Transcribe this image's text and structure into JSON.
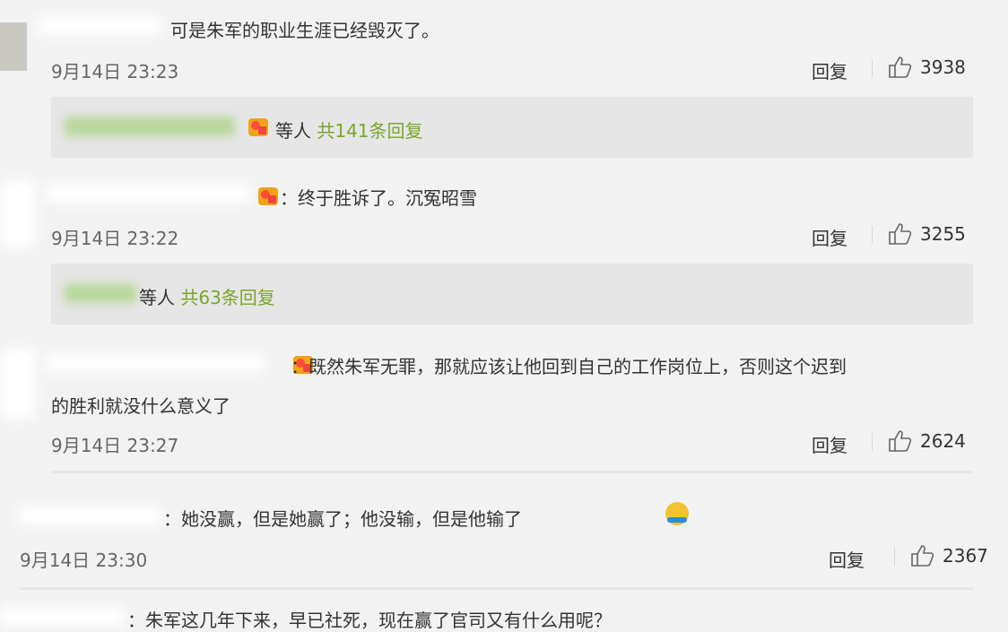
{
  "comments": [
    {
      "text": "可是朱军的职业生涯已经毁灭了。",
      "time": "9月14日 23:23",
      "reply_label": "回复",
      "likes": "3938",
      "thread": {
        "suffix": "等人",
        "more": "共141条回复"
      }
    },
    {
      "text": "：终于胜诉了。沉冤昭雪",
      "time": "9月14日 23:22",
      "reply_label": "回复",
      "likes": "3255",
      "thread": {
        "suffix": "等人",
        "more": "共63条回复"
      }
    },
    {
      "text_line1": "：既然朱军无罪，那就应该让他回到自己的工作岗位上，否则这个迟到",
      "text_line2": "的胜利就没什么意义了",
      "time": "9月14日 23:27",
      "reply_label": "回复",
      "likes": "2624"
    },
    {
      "text": "：她没赢，但是她赢了；他没输，但是他输了",
      "time": "9月14日 23:30",
      "reply_label": "回复",
      "likes": "2367"
    },
    {
      "text": "：朱军这几年下来，早已社死，现在赢了官司又有什么用呢？"
    }
  ],
  "colors": {
    "background": "#f2f2f2",
    "link_green": "#7aa52a",
    "sub_box": "#e6e6e6"
  }
}
